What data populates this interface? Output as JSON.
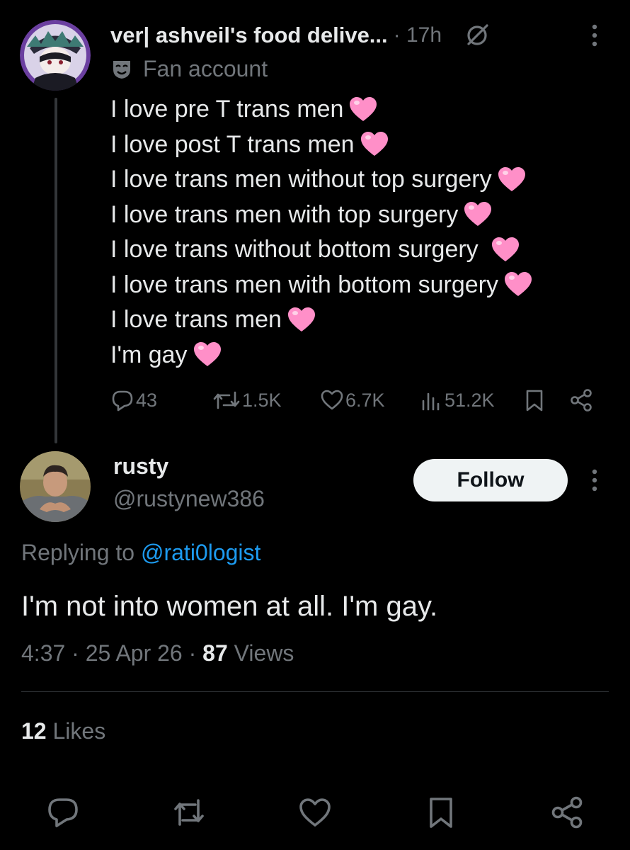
{
  "post": {
    "display_name": "ver| ashveil's food delive...",
    "time": "· 17h",
    "account_label": "Fan account",
    "lines": [
      "I love pre T trans men",
      "I love post T trans men",
      "I love trans men without top surgery",
      "I love trans men with top surgery",
      "I love trans without bottom surgery",
      "I love trans men with bottom surgery",
      "I love trans men",
      "I'm gay"
    ],
    "stats": {
      "replies": "43",
      "reposts": "1.5K",
      "likes": "6.7K",
      "views": "51.2K"
    }
  },
  "reply": {
    "display_name": "rusty",
    "handle": "@rustynew386",
    "follow_label": "Follow",
    "replying_to_prefix": "Replying to",
    "replying_to_handle": "@rati0logist",
    "text": "I'm not into women at all. I'm gay.",
    "time": "4:37",
    "date": "25 Apr 26",
    "views_count": "87",
    "views_label": "Views",
    "likes_count": "12",
    "likes_label": "Likes"
  },
  "colors": {
    "background": "#000000",
    "text_primary": "#e7e9ea",
    "text_secondary": "#71767b",
    "link": "#1d9bf0",
    "heart": "#ff8fc8"
  },
  "icons": [
    "grok-icon",
    "more-icon",
    "fan-account-icon",
    "heart-emoji",
    "reply-icon",
    "repost-icon",
    "like-icon",
    "views-icon",
    "bookmark-icon",
    "share-icon"
  ]
}
